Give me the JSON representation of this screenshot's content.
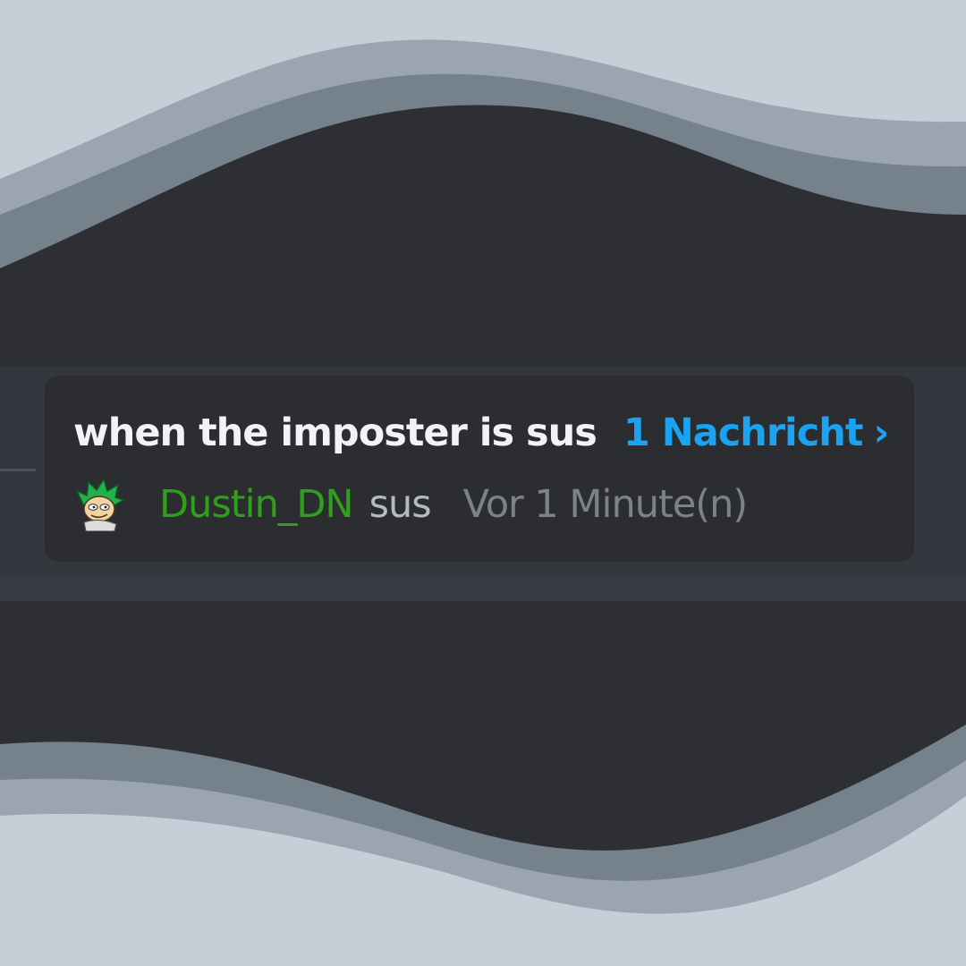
{
  "colors": {
    "background_light": "#c6cfd8",
    "wave_light": "#9aa5b1",
    "wave_mid": "#75818b",
    "wave_dark": "#2d2f34",
    "card_bg": "#2b2d31",
    "title_text": "#f2f3f5",
    "link_blue": "#1aa3f0",
    "author_green": "#2fa01a",
    "preview_text": "#b5bac1",
    "timestamp_text": "#7d8188"
  },
  "thread": {
    "title": "when the imposter is sus",
    "message_count": "1 Nachricht",
    "chevron_icon": "chevron-right-icon",
    "last_message": {
      "avatar_icon": "avatar",
      "author": "Dustin_DN",
      "text": "sus",
      "timestamp": "Vor 1 Minute(n)"
    }
  }
}
